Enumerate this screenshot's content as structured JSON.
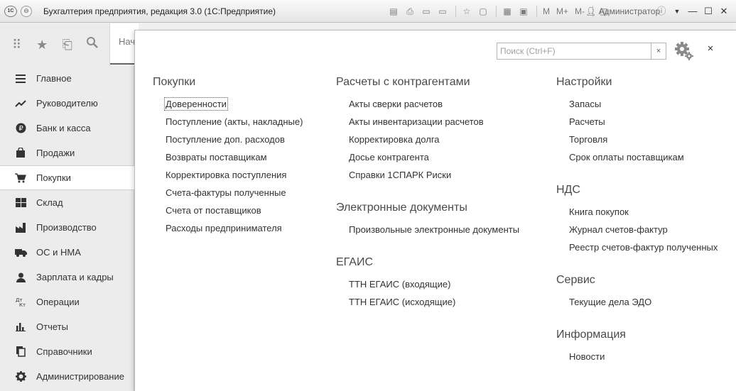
{
  "window": {
    "title": "Бухгалтерия предприятия, редакция 3.0  (1С:Предприятие)",
    "logo": "1С",
    "user": "Администратор",
    "toolbar_icons": [
      "save-icon",
      "print-icon",
      "document-icon",
      "document-icon",
      "star-icon",
      "bookmark-icon",
      "table-icon",
      "calendar-icon"
    ],
    "memory_buttons": [
      "M",
      "M+",
      "M-"
    ]
  },
  "home_tab": {
    "label": "Нач"
  },
  "sections": [
    {
      "label": "Главное",
      "icon": "hamburger-icon"
    },
    {
      "label": "Руководителю",
      "icon": "trend-icon"
    },
    {
      "label": "Банк и касса",
      "icon": "ruble-icon"
    },
    {
      "label": "Продажи",
      "icon": "bag-icon"
    },
    {
      "label": "Покупки",
      "icon": "cart-icon",
      "active": true
    },
    {
      "label": "Склад",
      "icon": "warehouse-icon"
    },
    {
      "label": "Производство",
      "icon": "factory-icon"
    },
    {
      "label": "ОС и НМА",
      "icon": "truck-icon"
    },
    {
      "label": "Зарплата и кадры",
      "icon": "person-icon"
    },
    {
      "label": "Операции",
      "icon": "dt-kt-icon"
    },
    {
      "label": "Отчеты",
      "icon": "bar-chart-icon"
    },
    {
      "label": "Справочники",
      "icon": "books-icon"
    },
    {
      "label": "Администрирование",
      "icon": "gear-icon"
    }
  ],
  "search": {
    "placeholder": "Поиск (Ctrl+F)",
    "clear": "×"
  },
  "panel": {
    "close": "×",
    "col1": {
      "groups": [
        {
          "title": "Покупки",
          "items": [
            "Доверенности",
            "Поступление (акты, накладные)",
            "Поступление доп. расходов",
            "Возвраты поставщикам",
            "Корректировка поступления",
            "Счета-фактуры полученные",
            "Счета от поставщиков",
            "Расходы предпринимателя"
          ]
        }
      ]
    },
    "col2": {
      "groups": [
        {
          "title": "Расчеты с контрагентами",
          "items": [
            "Акты сверки расчетов",
            "Акты инвентаризации расчетов",
            "Корректировка долга",
            "Досье контрагента",
            "Справки 1СПАРК Риски"
          ]
        },
        {
          "title": "Электронные документы",
          "items": [
            "Произвольные электронные документы"
          ]
        },
        {
          "title": "ЕГАИС",
          "items": [
            "ТТН ЕГАИС (входящие)",
            "ТТН ЕГАИС (исходящие)"
          ]
        }
      ]
    },
    "col3": {
      "groups": [
        {
          "title": "Настройки",
          "items": [
            "Запасы",
            "Расчеты",
            "Торговля",
            "Срок оплаты поставщикам"
          ]
        },
        {
          "title": "НДС",
          "items": [
            "Книга покупок",
            "Журнал счетов-фактур",
            "Реестр счетов-фактур полученных"
          ]
        },
        {
          "title": "Сервис",
          "items": [
            "Текущие дела ЭДО"
          ]
        },
        {
          "title": "Информация",
          "items": [
            "Новости"
          ]
        }
      ]
    }
  }
}
